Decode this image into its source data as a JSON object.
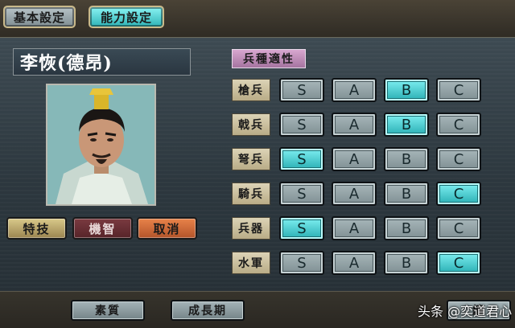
{
  "tabs": {
    "basic": "基本設定",
    "ability": "能力設定"
  },
  "character": {
    "name": "李恢(德昂)"
  },
  "commands": {
    "skill": "特技",
    "wit": "機智",
    "cancel": "取消"
  },
  "aptitude": {
    "header": "兵種適性",
    "grades": [
      "S",
      "A",
      "B",
      "C"
    ],
    "rows": [
      {
        "label": "槍兵",
        "selected": "B"
      },
      {
        "label": "戟兵",
        "selected": "B"
      },
      {
        "label": "弩兵",
        "selected": "S"
      },
      {
        "label": "騎兵",
        "selected": "C"
      },
      {
        "label": "兵器",
        "selected": "S"
      },
      {
        "label": "水軍",
        "selected": "C"
      }
    ]
  },
  "bottom": {
    "quality": "素質",
    "growth": "成長期",
    "continue": "續"
  },
  "watermark": "头条 @奕道君心",
  "colors": {
    "selected_grade": "#29aeb3",
    "unselected_grade": "#8a999d",
    "label_bg": "#cfc4a2",
    "header_bg": "#c28fbb"
  }
}
